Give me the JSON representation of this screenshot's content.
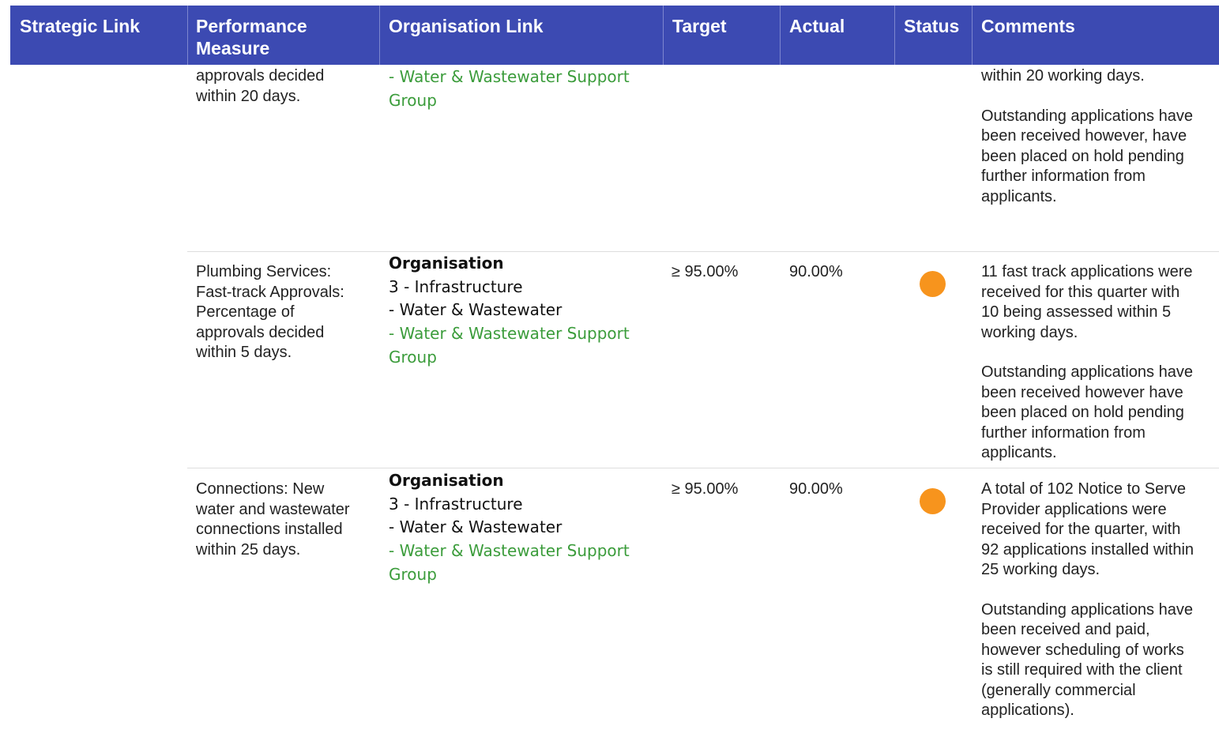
{
  "table": {
    "columns": [
      "Strategic Link",
      "Performance Measure",
      "Organisation Link",
      "Target",
      "Actual",
      "Status",
      "Comments"
    ],
    "columns_wrapped": {
      "performance_measure": [
        "Performance",
        "Measure"
      ]
    },
    "status_color": "#f7941d",
    "header_color": "#3c4ab2",
    "green_text_color": "#3b9c3b",
    "rows": [
      {
        "measure_lines": [
          "approvals decided",
          "within 20 days."
        ],
        "org_lines": [
          {
            "text": "- Water & Wastewater Support",
            "style": "green"
          },
          {
            "text": "Group",
            "style": "green"
          }
        ],
        "target": "",
        "actual": "",
        "status_icon": "",
        "comment_paragraphs": [
          "within 20 working days.",
          "Outstanding applications have been received however, have been placed on hold pending further information from applicants."
        ],
        "comment_lines": [
          [
            "within 20 working days."
          ],
          [
            "Outstanding applications have",
            "been received however, have",
            "been placed on hold pending",
            "further information from",
            "applicants."
          ]
        ]
      },
      {
        "measure_lines": [
          "Plumbing Services:",
          "Fast-track Approvals:",
          "Percentage of",
          "approvals decided",
          "within 5 days."
        ],
        "org_lines": [
          {
            "text": "Organisation",
            "style": "bold"
          },
          {
            "text": "3 - Infrastructure",
            "style": "normal"
          },
          {
            "text": "- Water & Wastewater",
            "style": "normal"
          },
          {
            "text": "- Water & Wastewater Support",
            "style": "green"
          },
          {
            "text": "Group",
            "style": "green"
          }
        ],
        "target": "≥ 95.00%",
        "actual": "90.00%",
        "status_icon": "orange-circle",
        "comment_lines": [
          [
            "11 fast track applications were",
            "received for this quarter with",
            "10 being assessed within 5",
            "working days."
          ],
          [
            "Outstanding applications have",
            "been received however have",
            "been placed on hold pending",
            "further information from",
            "applicants."
          ]
        ]
      },
      {
        "measure_lines": [
          "Connections: New",
          "water and wastewater",
          "connections installed",
          "within 25 days."
        ],
        "org_lines": [
          {
            "text": "Organisation",
            "style": "bold"
          },
          {
            "text": "3 - Infrastructure",
            "style": "normal"
          },
          {
            "text": "- Water & Wastewater",
            "style": "normal"
          },
          {
            "text": "- Water & Wastewater Support",
            "style": "green"
          },
          {
            "text": "Group",
            "style": "green"
          }
        ],
        "target": "≥ 95.00%",
        "actual": "90.00%",
        "status_icon": "orange-circle",
        "comment_lines": [
          [
            "A total of 102 Notice to Serve",
            "Provider applications were",
            "received for the quarter, with",
            "92 applications installed within",
            "25 working days."
          ],
          [
            "Outstanding applications have",
            "been received and paid,",
            "however scheduling of works",
            "is still required with the client",
            "(generally commercial",
            "applications)."
          ]
        ]
      }
    ]
  }
}
